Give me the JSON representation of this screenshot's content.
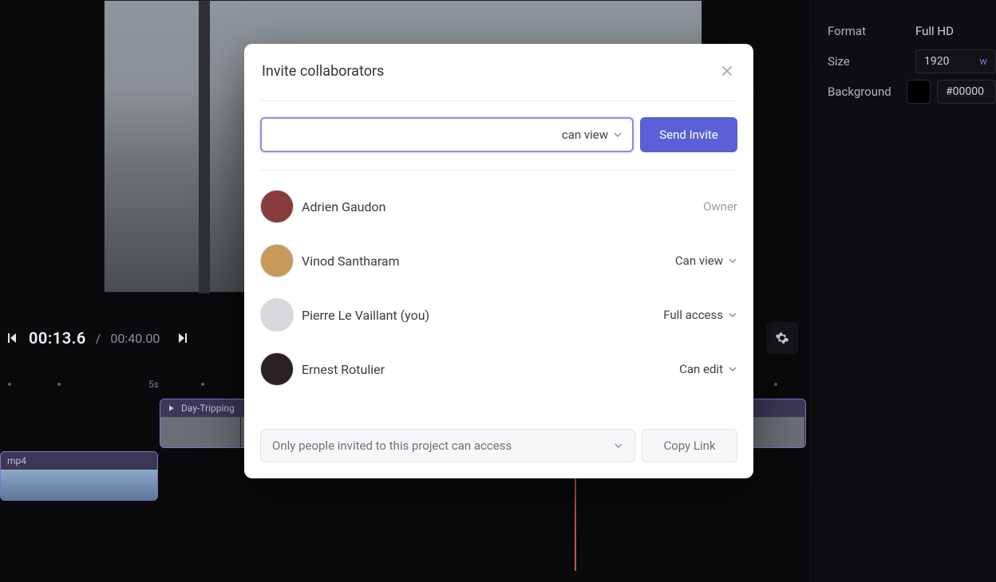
{
  "editor": {
    "time_current": "00:13.6",
    "time_separator": "/",
    "time_duration": "00:40.00",
    "ruler_label": "5s",
    "clip1_name": "Day-Tripping",
    "clip2_name": "mp4"
  },
  "sidepanel": {
    "format_label": "Format",
    "format_value": "Full HD",
    "size_label": "Size",
    "size_value": "1920",
    "size_unit": "w",
    "background_label": "Background",
    "background_value": "#00000"
  },
  "modal": {
    "title": "Invite collaborators",
    "permission_selected": "can view",
    "send_label": "Send Invite",
    "access_scope": "Only people invited to this project can access",
    "copy_label": "Copy Link",
    "people": [
      {
        "name": "Adrien Gaudon",
        "role": "Owner",
        "editable": false
      },
      {
        "name": "Vinod Santharam",
        "role": "Can view",
        "editable": true
      },
      {
        "name": "Pierre Le Vaillant (you)",
        "role": "Full access",
        "editable": true
      },
      {
        "name": "Ernest Rotulier",
        "role": "Can edit",
        "editable": true
      }
    ]
  },
  "avatar_colors": [
    "#8a3b3b",
    "#c79a5a",
    "#d8d9dc",
    "#2b2024"
  ]
}
